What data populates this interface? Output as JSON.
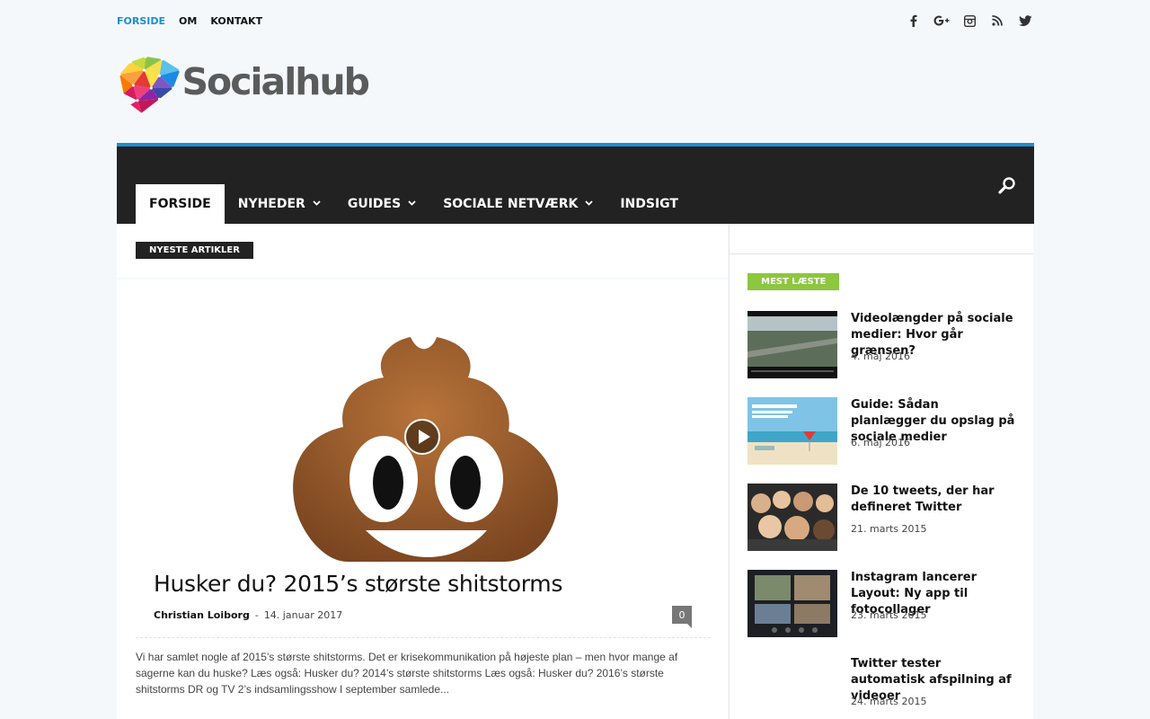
{
  "topmenu": [
    {
      "label": "FORSIDE",
      "active": true
    },
    {
      "label": "OM",
      "active": false
    },
    {
      "label": "KONTAKT",
      "active": false
    }
  ],
  "social_icons": [
    "facebook-icon",
    "google-plus-icon",
    "instagram-icon",
    "rss-icon",
    "twitter-icon"
  ],
  "logo": {
    "text": "Socialhub"
  },
  "nav": [
    {
      "label": "FORSIDE",
      "active": true,
      "dropdown": false
    },
    {
      "label": "NYHEDER",
      "active": false,
      "dropdown": true
    },
    {
      "label": "GUIDES",
      "active": false,
      "dropdown": true
    },
    {
      "label": "SOCIALE NETVÆRK",
      "active": false,
      "dropdown": true
    },
    {
      "label": "INDSIGT",
      "active": false,
      "dropdown": false
    }
  ],
  "main": {
    "block_title": "NYESTE ARTIKLER",
    "feature": {
      "title": "Husker du? 2015’s største shitstorms",
      "author": "Christian Loiborg",
      "separator": "-",
      "date": "14. januar 2017",
      "comments": "0",
      "excerpt": "Vi har samlet nogle af 2015’s største shitstorms. Det er krisekommunikation på højeste plan – men hvor mange af sagerne kan du huske? Læs også: Husker du? 2014’s største shitstorms Læs også: Husker du? 2016’s største shitstorms DR og TV 2’s indsamlingsshow I september samlede..."
    }
  },
  "sidebar": {
    "block_title": "MEST LÆSTE",
    "items": [
      {
        "title": "Videolængder på sociale medier: Hvor går grænsen?",
        "date": "4. maj 2016"
      },
      {
        "title": "Guide: Sådan planlægger du opslag på sociale medier",
        "date": "6. maj 2016"
      },
      {
        "title": "De 10 tweets, der har defineret Twitter",
        "date": "21. marts 2015"
      },
      {
        "title": "Instagram lancerer Layout: Ny app til fotocollager",
        "date": "23. marts 2015"
      },
      {
        "title": "Twitter tester automatisk afspilning af videoer",
        "date": "24. marts 2015"
      }
    ]
  },
  "colors": {
    "accent": "#1e8ecf",
    "nav_bg": "#222222",
    "sidebar_badge": "#8dc63f"
  }
}
